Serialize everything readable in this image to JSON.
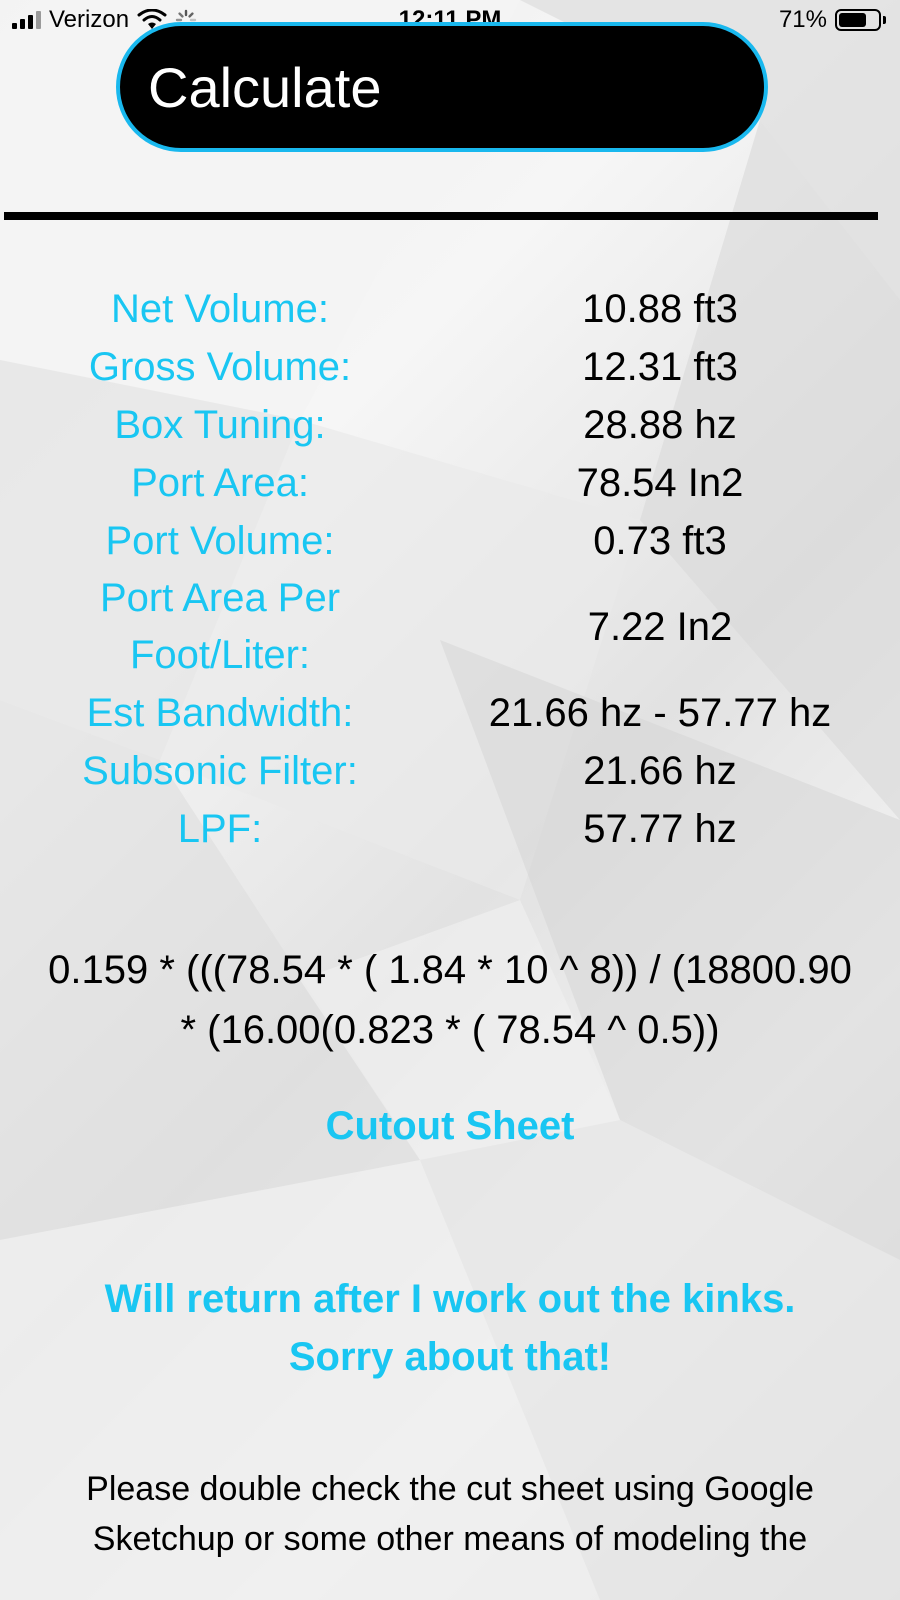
{
  "status_bar": {
    "carrier": "Verizon",
    "time": "12:11 PM",
    "battery_percent": "71%",
    "battery_level": 0.71,
    "signal_icon": "signal-bars-icon",
    "wifi_icon": "wifi-icon",
    "activity_icon": "loading-spinner-icon"
  },
  "calculate_button": {
    "label": "Calculate"
  },
  "results": [
    {
      "label": "Net Volume:",
      "value": "10.88 ft3"
    },
    {
      "label": "Gross Volume:",
      "value": "12.31 ft3"
    },
    {
      "label": "Box Tuning:",
      "value": "28.88 hz"
    },
    {
      "label": "Port Area:",
      "value": "78.54 In2"
    },
    {
      "label": "Port Volume:",
      "value": "0.73 ft3"
    },
    {
      "label_line1": "Port Area Per",
      "label_line2": "Foot/Liter:",
      "value": "7.22 In2"
    },
    {
      "label": "Est Bandwidth:",
      "value": "21.66 hz - 57.77 hz"
    },
    {
      "label": "Subsonic Filter:",
      "value": "21.66 hz"
    },
    {
      "label": "LPF:",
      "value": "57.77 hz"
    }
  ],
  "formula": {
    "line1": "0.159 * (((78.54 * ( 1.84 * 10 ^ 8)) / (18800.90",
    "line2": "* (16.00(0.823 * ( 78.54 ^ 0.5))"
  },
  "cutout_link": "Cutout Sheet",
  "notice": {
    "line1": "Will return after I work out the kinks.",
    "line2": "Sorry about that!"
  },
  "disclaimer": {
    "line1": "Please double check the cut sheet using Google",
    "line2": "Sketchup or some other means of modeling the"
  },
  "colors": {
    "accent": "#19c6f2",
    "button_border": "#19b8ee",
    "button_bg": "#000000",
    "text": "#000000"
  }
}
